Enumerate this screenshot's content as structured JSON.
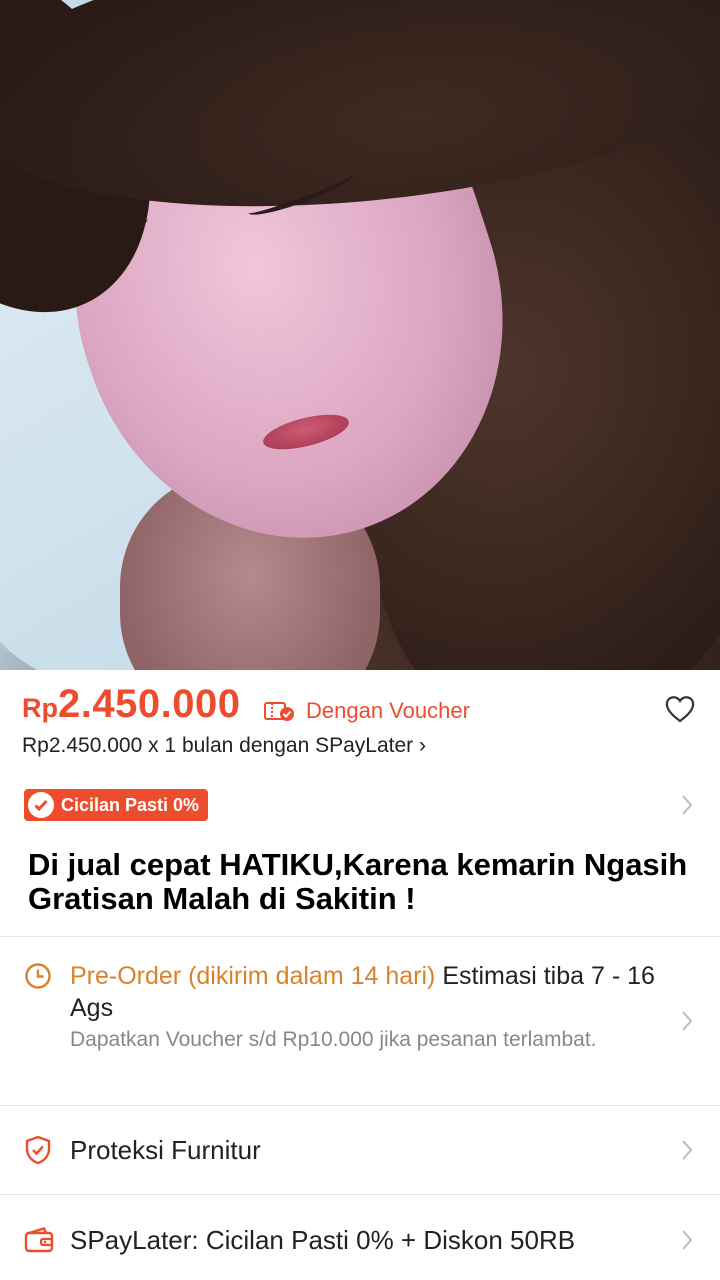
{
  "product": {
    "price_currency": "Rp",
    "price_value": "2.450.000",
    "voucher_label": "Dengan Voucher",
    "spaylater_line": "Rp2.450.000 x 1 bulan dengan SPayLater",
    "badge_label": "Cicilan Pasti 0%",
    "title": "Di jual cepat HATIKU,Karena kemarin Ngasih Gratisan Malah di Sakitin !"
  },
  "shipping": {
    "preorder_label": "Pre-Order (dikirim dalam 14 hari)",
    "estimate_text": " Estimasi tiba 7 - 16 Ags",
    "voucher_note": "Dapatkan Voucher s/d Rp10.000 jika pesanan terlambat."
  },
  "protection": {
    "label": "Proteksi Furnitur"
  },
  "paylater": {
    "label": "SPayLater: Cicilan Pasti 0% + Diskon 50RB"
  },
  "colors": {
    "accent": "#ee4d2d",
    "preorder": "#d9822b"
  },
  "icons": {
    "voucher": "voucher-check-icon",
    "favorite": "heart-icon",
    "badge": "check-circle-icon",
    "preorder": "clock-icon",
    "protection": "shield-check-icon",
    "paylater": "wallet-icon",
    "chevron": "chevron-right-icon"
  }
}
